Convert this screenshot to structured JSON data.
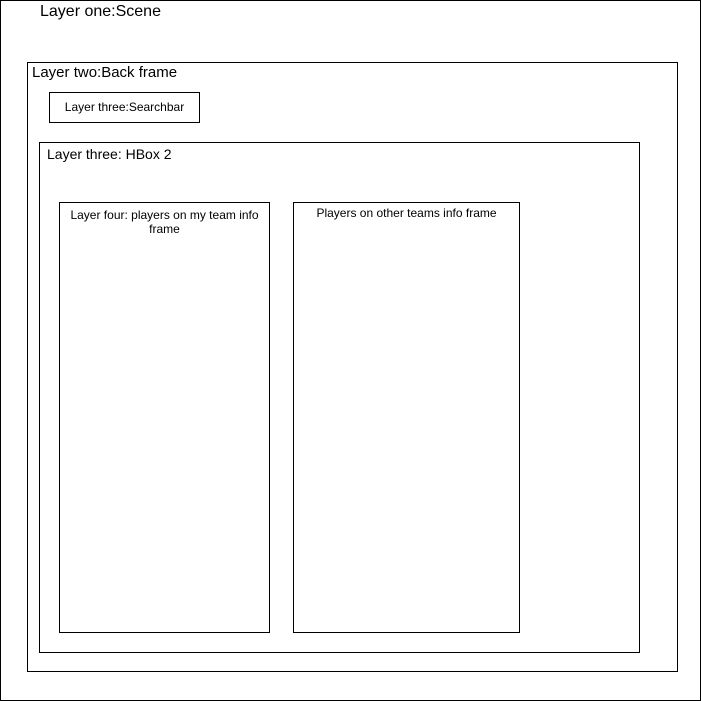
{
  "scene": {
    "label": "Layer one:Scene"
  },
  "back_frame": {
    "label": "Layer two:Back frame"
  },
  "searchbar": {
    "label": "Layer three:Searchbar"
  },
  "hbox2": {
    "label": "Layer three: HBox 2"
  },
  "my_team_frame": {
    "label": "Layer four: players on my team info frame"
  },
  "other_teams_frame": {
    "label": "Players on other teams info frame"
  }
}
